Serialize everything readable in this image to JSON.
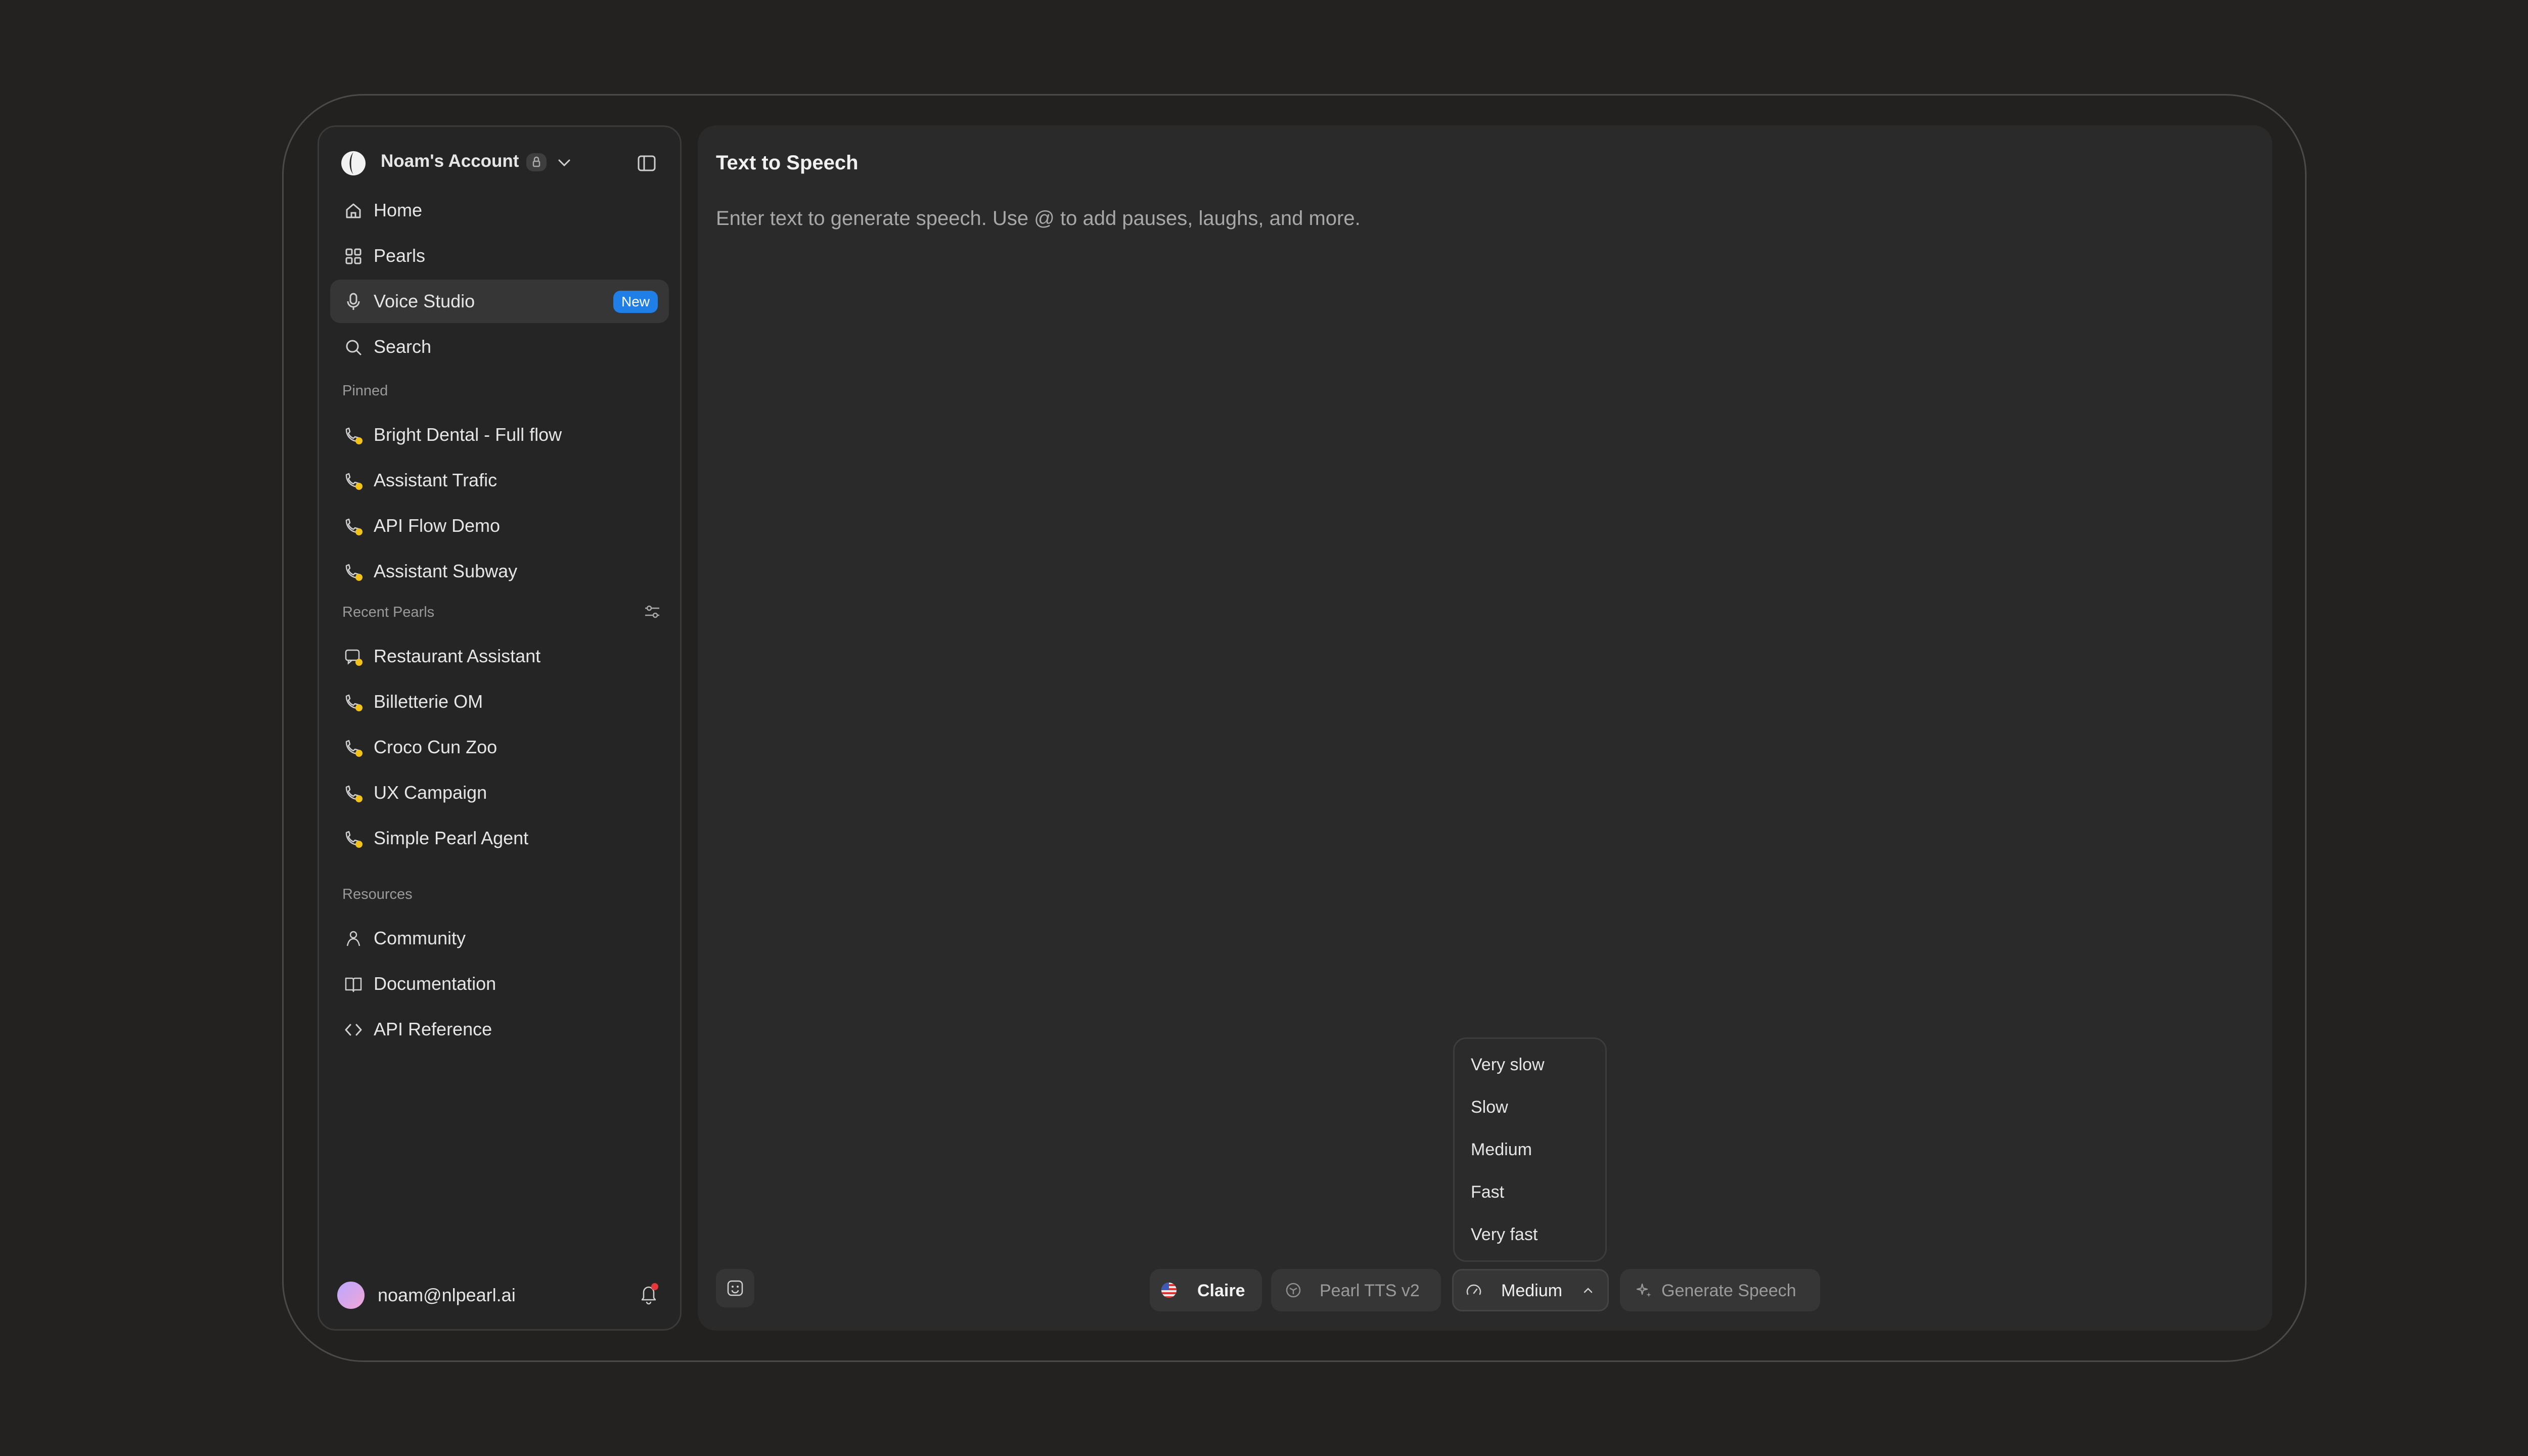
{
  "sidebar": {
    "account_name": "Noam's Account",
    "nav": [
      {
        "label": "Home",
        "icon": "home-icon"
      },
      {
        "label": "Pearls",
        "icon": "grid-icon"
      },
      {
        "label": "Voice Studio",
        "icon": "microphone-icon",
        "badge": "New",
        "active": true
      },
      {
        "label": "Search",
        "icon": "search-icon"
      }
    ],
    "pinned_label": "Pinned",
    "pinned": [
      "Bright Dental - Full flow",
      "Assistant Trafic",
      "API Flow Demo",
      "Assistant Subway"
    ],
    "recent_label": "Recent Pearls",
    "recent": [
      "Restaurant Assistant",
      "Billetterie OM",
      "Croco Cun Zoo",
      "UX Campaign",
      "Simple Pearl Agent"
    ],
    "resources_label": "Resources",
    "resources": [
      {
        "label": "Community",
        "icon": "community-icon"
      },
      {
        "label": "Documentation",
        "icon": "book-icon"
      },
      {
        "label": "API Reference",
        "icon": "code-icon"
      }
    ],
    "user_email": "noam@nlpearl.ai"
  },
  "main": {
    "title": "Text to Speech",
    "placeholder": "Enter text to generate speech. Use @ to add pauses, laughs, and more."
  },
  "toolbar": {
    "voice": "Claire",
    "model": "Pearl TTS v2",
    "speed": "Medium",
    "generate": "Generate Speech"
  },
  "speed_menu": {
    "options": [
      "Very slow",
      "Slow",
      "Medium",
      "Fast",
      "Very fast"
    ]
  },
  "colors": {
    "accent_blue": "#1f7fe6",
    "status_yellow": "#f0c21b",
    "notification_red": "#e5383b"
  }
}
